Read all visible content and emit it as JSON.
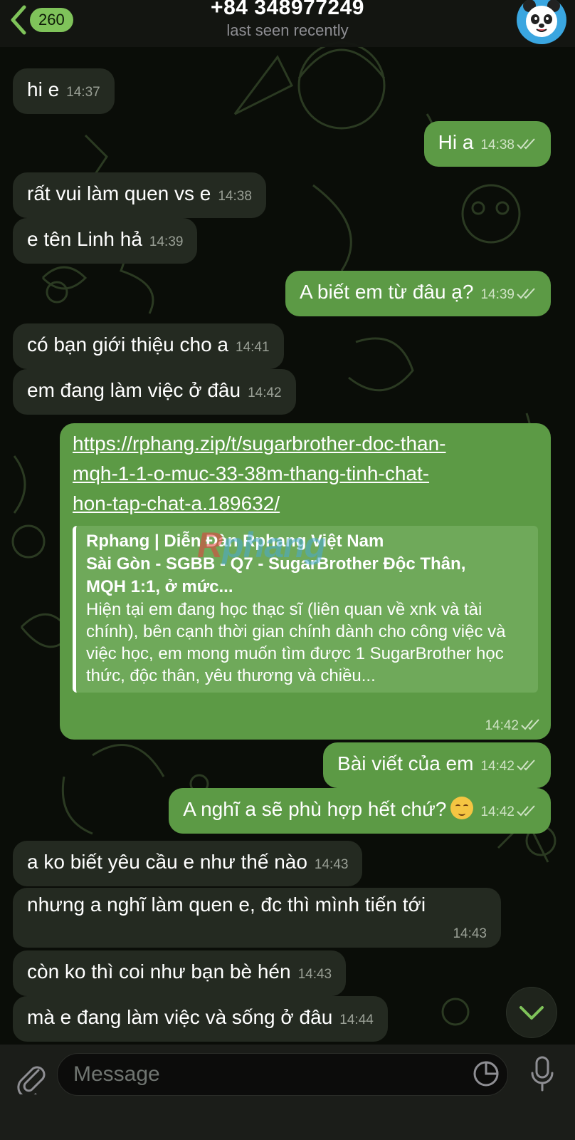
{
  "header": {
    "back_badge": "260",
    "title": "+84 348977249",
    "subtitle": "last seen recently"
  },
  "messages": [
    {
      "dir": "in",
      "text": "hi e",
      "time": "14:37"
    },
    {
      "dir": "out",
      "text": "Hi a",
      "time": "14:38"
    },
    {
      "dir": "in",
      "text": "rất vui làm quen vs e",
      "time": "14:38"
    },
    {
      "dir": "in",
      "text": "e tên Linh hả",
      "time": "14:39"
    },
    {
      "dir": "out",
      "text": "A biết em từ đâu ạ?",
      "time": "14:39"
    },
    {
      "dir": "in",
      "text": "có bạn giới thiệu cho a",
      "time": "14:41"
    },
    {
      "dir": "in",
      "text": "em đang làm việc ở đâu",
      "time": "14:42"
    },
    {
      "dir": "out",
      "text": "Bài viết của em",
      "time": "14:42"
    },
    {
      "dir": "out",
      "text": "A nghĩ a sẽ phù hợp hết chứ?",
      "time": "14:42"
    },
    {
      "dir": "in",
      "text": "a ko biết yêu cầu e như thế nào",
      "time": "14:43"
    },
    {
      "dir": "in",
      "text": "còn ko thì coi như bạn bè hén",
      "time": "14:43"
    },
    {
      "dir": "in",
      "text": "mà e đang làm việc và sống ở đâu",
      "time": "14:44"
    }
  ],
  "link_message": {
    "url_lines": [
      "https://rphang.zip/t/sugarbrother-doc-than-",
      "mqh-1-1-o-muc-33-38m-thang-tinh-chat-",
      "hon-tap-chat-a.189632/"
    ],
    "preview_site": "Rphang | Diễn Đàn Rphang Việt Nam",
    "preview_title_1": "Sài Gòn - SGBB - Q7 - SugarBrother Độc Thân,",
    "preview_title_2": "MQH 1:1, ở mức...",
    "preview_desc": "Hiện tại em đang học thạc sĩ (liên quan về xnk và tài chính), bên cạnh thời gian chính dành cho công việc và việc học, em mong muốn tìm được 1 SugarBrother học thức, độc thân, yêu thương và chiều...",
    "watermark_a": "R",
    "watermark_b": "phang",
    "time": "14:42"
  },
  "multiline_message": {
    "text": "nhưng a nghĩ làm quen e, đc thì mình tiến tới",
    "time": "14:43"
  },
  "input": {
    "placeholder": "Message"
  },
  "colors": {
    "incoming_bubble": "#242a21",
    "outgoing_bubble": "#5c9a45",
    "badge": "#7fc35a"
  },
  "icons": [
    "back-chevron-icon",
    "avatar-panda-icon",
    "read-ticks-icon",
    "smiling-emoji-icon",
    "scroll-down-chevron-icon",
    "attach-paperclip-icon",
    "sticker-icon",
    "microphone-icon"
  ]
}
